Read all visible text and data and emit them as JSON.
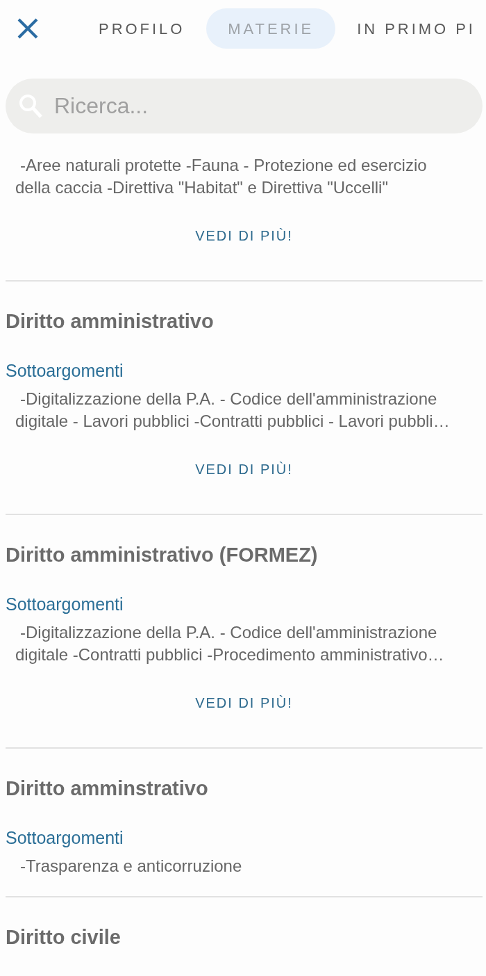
{
  "header": {
    "tabs": [
      {
        "label": "PROFILO",
        "selected": false
      },
      {
        "label": "MATERIE",
        "selected": true
      },
      {
        "label": "IN PRIMO PI",
        "selected": false
      }
    ]
  },
  "search": {
    "placeholder": "Ricerca..."
  },
  "subjects": [
    {
      "description": "-Aree naturali protette -Fauna - Protezione ed esercizio della caccia -Direttiva \"Habitat\" e Direttiva \"Uccelli\"",
      "more_link": "VEDI DI PIÙ!"
    },
    {
      "title": "Diritto amministrativo",
      "subtopics_label": "Sottoargomenti",
      "description": "-Digitalizzazione della P.A. - Codice dell'amministrazione digitale - Lavori pubblici -Contratti pubblici - Lavori pubbli…",
      "more_link": "VEDI DI PIÙ!"
    },
    {
      "title": "Diritto amministrativo (FORMEZ)",
      "subtopics_label": "Sottoargomenti",
      "description": "-Digitalizzazione della P.A. - Codice dell'amministrazione digitale -Contratti pubblici -Procedimento amministrativo…",
      "more_link": "VEDI DI PIÙ!"
    },
    {
      "title": "Diritto amminstrativo",
      "subtopics_label": "Sottoargomenti",
      "description": "-Trasparenza e anticorruzione"
    },
    {
      "title": "Diritto civile"
    }
  ]
}
